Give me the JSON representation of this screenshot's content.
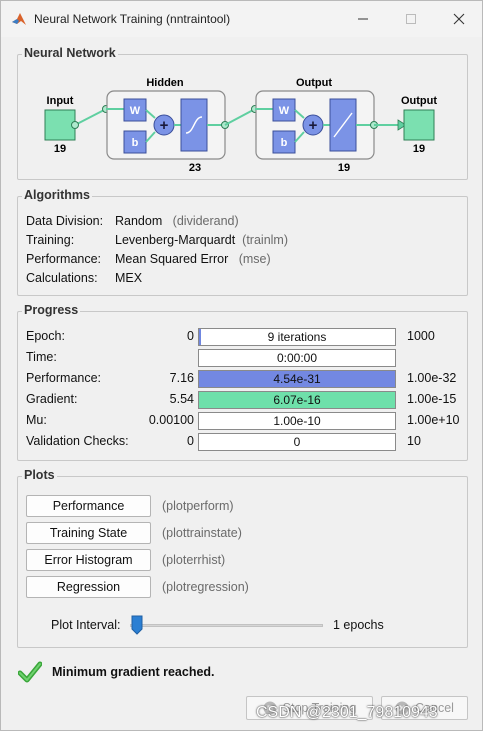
{
  "window": {
    "title": "Neural Network Training (nntraintool)"
  },
  "network": {
    "group_title": "Neural Network",
    "input_label": "Input",
    "input_size": "19",
    "hidden_label": "Hidden",
    "hidden_size": "23",
    "output_layer_label": "Output",
    "output_layer_size": "19",
    "output_label": "Output",
    "output_size": "19",
    "w": "W",
    "b": "b"
  },
  "algorithms": {
    "group_title": "Algorithms",
    "rows": [
      {
        "key": "Data Division:",
        "value": "Random",
        "hint": "(dividerand)"
      },
      {
        "key": "Training:",
        "value": "Levenberg-Marquardt",
        "hint": "(trainlm)"
      },
      {
        "key": "Performance:",
        "value": "Mean Squared Error",
        "hint": "(mse)"
      },
      {
        "key": "Calculations:",
        "value": "MEX",
        "hint": ""
      }
    ]
  },
  "progress": {
    "group_title": "Progress",
    "rows": [
      {
        "key": "Epoch:",
        "low": "0",
        "text": "9 iterations",
        "high": "1000",
        "fill": 0.009,
        "color": "#6f86e0"
      },
      {
        "key": "Time:",
        "low": "",
        "text": "0:00:00",
        "high": "",
        "fill": 0,
        "color": "#ffffff"
      },
      {
        "key": "Performance:",
        "low": "7.16",
        "text": "4.54e-31",
        "high": "1.00e-32",
        "fill": 1.0,
        "color": "#7388e2"
      },
      {
        "key": "Gradient:",
        "low": "5.54",
        "text": "6.07e-16",
        "high": "1.00e-15",
        "fill": 1.0,
        "color": "#6ee0aa"
      },
      {
        "key": "Mu:",
        "low": "0.00100",
        "text": "1.00e-10",
        "high": "1.00e+10",
        "fill": 0,
        "color": "#ffffff"
      },
      {
        "key": "Validation Checks:",
        "low": "0",
        "text": "0",
        "high": "10",
        "fill": 0,
        "color": "#ffffff"
      }
    ]
  },
  "plots": {
    "group_title": "Plots",
    "buttons": [
      {
        "label": "Performance",
        "fn": "(plotperform)"
      },
      {
        "label": "Training State",
        "fn": "(plottrainstate)"
      },
      {
        "label": "Error Histogram",
        "fn": "(ploterrhist)"
      },
      {
        "label": "Regression",
        "fn": "(plotregression)"
      }
    ],
    "interval_label": "Plot Interval:",
    "interval_value": "1 epochs"
  },
  "status": {
    "message": "Minimum gradient reached."
  },
  "buttons": {
    "stop": "Stop Training",
    "cancel": "Cancel"
  },
  "watermark": "CSDN @2301_79810943",
  "colors": {
    "node_green": "#7be0b0",
    "weight_blue": "#7b93e6",
    "check_green": "#3aa63a"
  }
}
